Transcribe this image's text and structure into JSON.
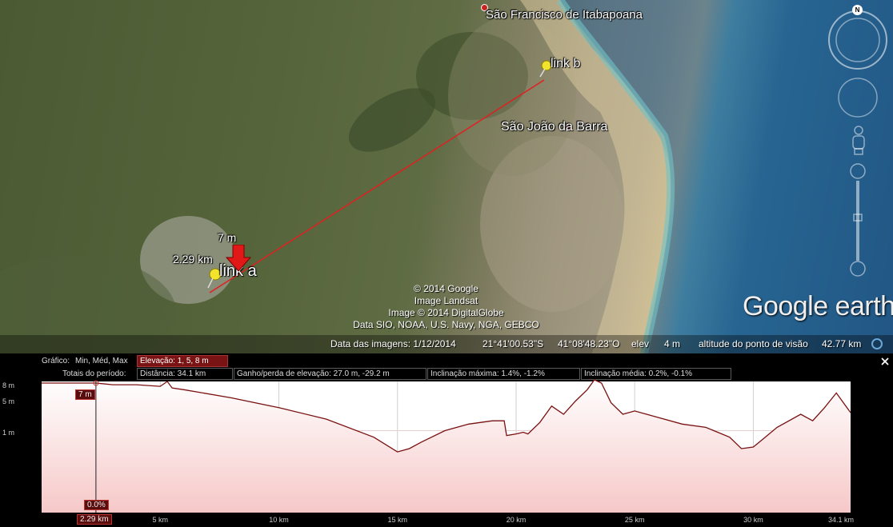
{
  "map": {
    "places": [
      "São Francisco de Itabapoana",
      "São João da Barra"
    ],
    "placemarks": [
      {
        "name": "link b"
      },
      {
        "name": "link a"
      }
    ],
    "cursor_elevation": "7 m",
    "cursor_distance": "2.29 km",
    "compass_letter": "N",
    "attribution": [
      "© 2014 Google",
      "Image Landsat",
      "Image © 2014 DigitalGlobe",
      "Data SIO, NOAA, U.S. Navy, NGA, GEBCO"
    ],
    "logo": "Google earth",
    "path_color": "#e02020"
  },
  "statusbar": {
    "imagery_date": "Data das imagens: 1/12/2014",
    "lat": "21°41'00.53\"S",
    "lon": "41°08'48.23\"O",
    "elev_label": "elev",
    "elev_value": "4 m",
    "eye_alt_label": "altitude do ponto de visão",
    "eye_alt_value": "42.77 km"
  },
  "profile": {
    "graph_label": "Gráfico:",
    "graph_options": "Min, Méd, Max",
    "elevation_box": "Elevação: 1, 5, 8 m",
    "totals_label": "Totais do período:",
    "distance": "Distância: 34.1 km",
    "gain_loss": "Ganho/perda de elevação: 27.0 m, -29.2 m",
    "max_slope": "Inclinação máxima: 1.4%, -1.2%",
    "avg_slope": "Inclinação média: 0.2%, -0.1%",
    "close_icon": "close-icon",
    "cursor_elev_tag": "7 m",
    "cursor_slope_tag": "0.0%",
    "cursor_dist_tag": "2.29 km"
  },
  "chart_data": {
    "type": "area",
    "x_unit": "km",
    "y_unit": "m",
    "xlim": [
      0,
      34.1
    ],
    "ylim": [
      0,
      8
    ],
    "y_ticks": [
      "8 m",
      "5 m",
      "1 m"
    ],
    "x_ticks": [
      "5 km",
      "10 km",
      "15 km",
      "20 km",
      "25 km",
      "30 km",
      "34.1 km"
    ],
    "x": [
      0,
      1,
      2,
      2.29,
      3,
      4,
      5,
      5.3,
      5.5,
      6,
      8,
      10,
      12,
      14,
      15,
      15.5,
      16,
      17,
      18,
      19,
      19.5,
      19.6,
      20,
      20.3,
      20.5,
      21,
      21.5,
      22,
      22.5,
      23,
      23.3,
      23.6,
      24,
      24.5,
      25,
      26,
      27,
      28,
      29,
      29.5,
      30,
      30.5,
      31,
      32,
      32.5,
      33,
      33.5,
      34.1
    ],
    "y": [
      7.9,
      7.9,
      7.9,
      7.9,
      7.8,
      7.8,
      7.7,
      8.0,
      7.6,
      7.5,
      7.0,
      6.4,
      5.7,
      4.6,
      3.7,
      3.9,
      4.3,
      5.0,
      5.4,
      5.6,
      5.6,
      4.7,
      4.8,
      4.9,
      4.8,
      5.5,
      6.5,
      6.0,
      6.8,
      7.5,
      8.1,
      7.9,
      6.7,
      6.0,
      6.2,
      5.8,
      5.4,
      5.2,
      4.6,
      3.9,
      4.0,
      4.6,
      5.2,
      6.0,
      5.6,
      6.4,
      7.3,
      6.1
    ],
    "series": [
      {
        "name": "Elevação",
        "color": "#7a1010",
        "fill_top": "#ffffff",
        "fill_bottom": "#f6c8c8"
      }
    ],
    "cursor_x": 2.29,
    "grid": true
  }
}
